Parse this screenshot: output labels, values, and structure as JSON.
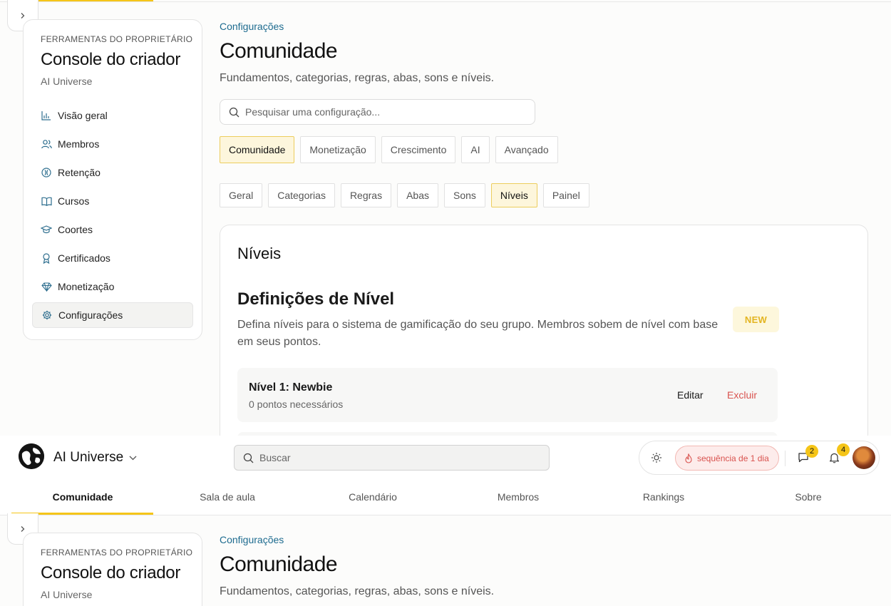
{
  "sidebar": {
    "kicker": "FERRAMENTAS DO PROPRIETÁRIO",
    "title": "Console do criador",
    "subtitle": "AI Universe",
    "items": [
      {
        "label": "Visão geral",
        "icon": "bar-chart-icon"
      },
      {
        "label": "Membros",
        "icon": "users-icon"
      },
      {
        "label": "Retenção",
        "icon": "retention-icon"
      },
      {
        "label": "Cursos",
        "icon": "book-icon"
      },
      {
        "label": "Coortes",
        "icon": "graduation-cap-icon"
      },
      {
        "label": "Certificados",
        "icon": "award-icon"
      },
      {
        "label": "Monetização",
        "icon": "gem-icon"
      },
      {
        "label": "Configurações",
        "icon": "gear-icon",
        "active": true
      }
    ]
  },
  "main": {
    "breadcrumb": "Configurações",
    "title": "Comunidade",
    "subtitle": "Fundamentos, categorias, regras, abas, sons e níveis.",
    "search_placeholder": "Pesquisar uma configuração...",
    "primary_tabs": [
      "Comunidade",
      "Monetização",
      "Crescimento",
      "AI",
      "Avançado"
    ],
    "primary_active": "Comunidade",
    "secondary_tabs": [
      "Geral",
      "Categorias",
      "Regras",
      "Abas",
      "Sons",
      "Níveis",
      "Painel"
    ],
    "secondary_active": "Níveis"
  },
  "card": {
    "heading": "Níveis",
    "section_title": "Definições de Nível",
    "description": "Defina níveis para o sistema de gamificação do seu grupo. Membros sobem de nível com base em seus pontos.",
    "badge": "NEW",
    "levels": [
      {
        "name": "Nível 1: Newbie",
        "points": "0 pontos necessários",
        "edit": "Editar",
        "delete": "Excluir"
      }
    ]
  },
  "header": {
    "brand": "AI Universe",
    "search_placeholder": "Buscar",
    "streak": "sequência de 1 dia",
    "messages_count": "2",
    "notifications_count": "4",
    "nav": [
      "Comunidade",
      "Sala de aula",
      "Calendário",
      "Membros",
      "Rankings",
      "Sobre"
    ],
    "nav_active": "Comunidade"
  },
  "colors": {
    "accent": "#f5c518",
    "link": "#1d6b8f",
    "danger": "#d9534f"
  }
}
